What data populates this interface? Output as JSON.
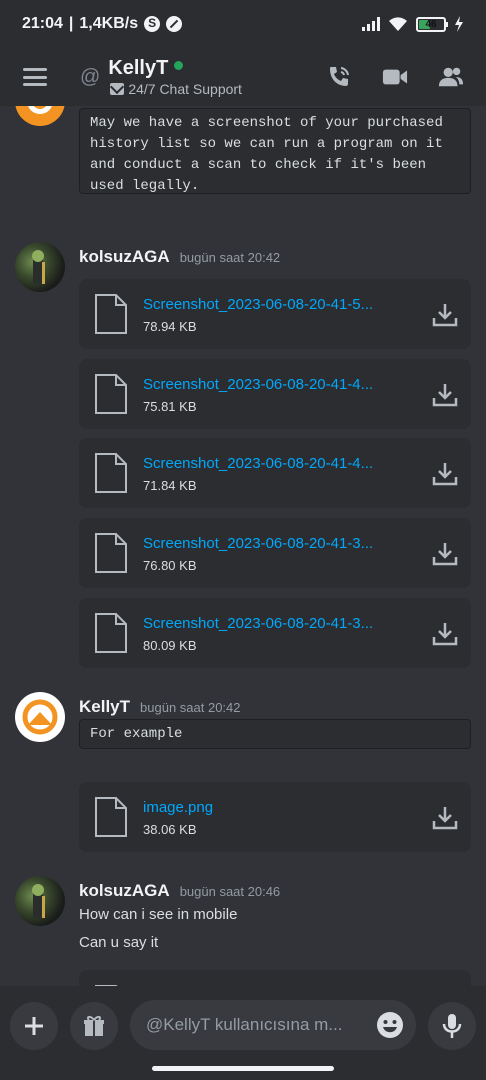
{
  "status_bar": {
    "time": "21:04",
    "separator": "|",
    "speed": "1,4KB/s",
    "battery": "46",
    "charging_icon": "bolt-icon"
  },
  "header": {
    "channel_name": "KellyT",
    "subtitle": "24/7 Chat Support",
    "icons": [
      "hamburger-icon",
      "at-icon",
      "voice-call-icon",
      "video-call-icon",
      "members-icon"
    ]
  },
  "messages": {
    "prev_message": {
      "text": "May we have a screenshot of your purchased\nhistory list so we can run a program on it\nand conduct a scan to check if it's been\nused legally."
    },
    "group1": {
      "author": "kolsuzAGA",
      "time": "bugün saat 20:42",
      "files": [
        {
          "name": "Screenshot_2023-06-08-20-41-5...",
          "size": "78.94 KB"
        },
        {
          "name": "Screenshot_2023-06-08-20-41-4...",
          "size": "75.81 KB"
        },
        {
          "name": "Screenshot_2023-06-08-20-41-4...",
          "size": "71.84 KB"
        },
        {
          "name": "Screenshot_2023-06-08-20-41-3...",
          "size": "76.80 KB"
        },
        {
          "name": "Screenshot_2023-06-08-20-41-3...",
          "size": "80.09 KB"
        }
      ]
    },
    "group2": {
      "author": "KellyT",
      "time": "bugün saat 20:42",
      "code": "For example",
      "file": {
        "name": "image.png",
        "size": "38.06 KB"
      }
    },
    "group3": {
      "author": "kolsuzAGA",
      "time": "bugün saat 20:46",
      "line1": "How can i see in mobile",
      "line2": "Can u say it"
    }
  },
  "composer": {
    "placeholder": "@KellyT kullanıcısına m...",
    "icons": [
      "plus-icon",
      "gift-icon",
      "emoji-icon",
      "microphone-icon"
    ]
  },
  "colors": {
    "background": "#313338",
    "bar": "#2b2d31",
    "link": "#00a8fc",
    "online": "#23a55a"
  }
}
